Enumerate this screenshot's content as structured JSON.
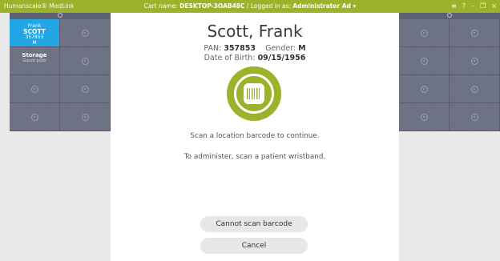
{
  "topbar": {
    "brand": "Humanscale® MedLink",
    "cart_label": "Cart name:",
    "cart_name": "DESKTOP-3OAB48C",
    "separator": "/",
    "logged_label": "Logged in as:",
    "user": "Administrator Ad",
    "controls": [
      "≡",
      "?",
      "–",
      "❐",
      "×"
    ]
  },
  "left_panel": {
    "patient": {
      "first": "Frank",
      "last": "SCOTT",
      "id": "357853",
      "gender": "M"
    },
    "storage": {
      "title": "Storage",
      "subtitle": "Gauze pads"
    }
  },
  "patient": {
    "name": "Scott, Frank",
    "pan_label": "PAN:",
    "pan": "357853",
    "gender_label": "Gender:",
    "gender": "M",
    "dob_label": "Date of Birth:",
    "dob": "09/15/1956"
  },
  "messages": {
    "scan_location": "Scan a location barcode to continue.",
    "administer": "To administer, scan a patient wristband."
  },
  "buttons": {
    "cannot_scan": "Cannot scan barcode",
    "cancel": "Cancel"
  }
}
